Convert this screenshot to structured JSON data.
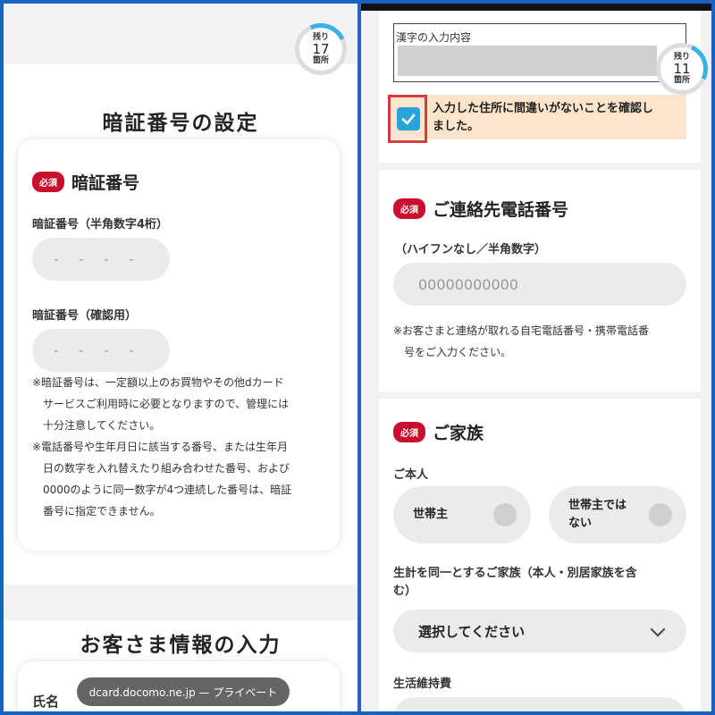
{
  "left": {
    "counter": {
      "prefix": "残り",
      "number": "17",
      "suffix": "箇所",
      "progress": 0.1
    },
    "pin_section": {
      "title": "暗証番号の設定",
      "badge": "必須",
      "field_title": "暗証番号",
      "label1": "暗証番号（半角数字4桁）",
      "placeholder1": "- - - -",
      "label2": "暗証番号（確認用）",
      "placeholder2": "- - - -",
      "note1_l1": "※暗証番号は、一定額以上のお買物やその他dカード",
      "note1_l2": "サービスご利用時に必要となりますので、管理には",
      "note1_l3": "十分注意してください。",
      "note2_l1": "※電話番号や生年月日に該当する番号、または生年月",
      "note2_l2": "日の数字を入れ替えたり組み合わせた番号、および",
      "note2_l3": "0000のように同一数字が4つ連続した番号は、暗証",
      "note2_l4": "番号に指定できません。"
    },
    "customer_section": {
      "title": "お客さま情報の入力",
      "name_label": "氏名"
    },
    "url_bar": "dcard.docomo.ne.jp — プライベート"
  },
  "right": {
    "counter": {
      "prefix": "残り",
      "number": "11",
      "suffix": "箇所",
      "progress": 0.25
    },
    "kanji_label": "漢字の入力内容",
    "confirm_line1": "入力した住所に間違いがないことを確認し",
    "confirm_line2": "ました。",
    "confirm_checked": true,
    "phone": {
      "badge": "必須",
      "title": "ご連絡先電話番号",
      "sublabel": "（ハイフンなし／半角数字）",
      "placeholder": "00000000000",
      "note_l1": "※お客さまと連絡が取れる自宅電話番号・携帯電話番",
      "note_l2": "号をご入力ください。"
    },
    "family": {
      "badge": "必須",
      "title": "ご家族",
      "self_label": "ご本人",
      "option1": "世帯主",
      "option2_l1": "世帯主では",
      "option2_l2": "ない",
      "household_label_l1": "生計を同一とするご家族（本人・別居家族を含",
      "household_label_l2": "む）",
      "select_value": "選択してください",
      "living_cost_label": "生活維持費"
    }
  },
  "colors": {
    "required_badge": "#c8102e",
    "accent_blue": "#2aa3d8",
    "frame_blue": "#1565c0",
    "highlight_red": "#d93a3a",
    "confirm_bg": "#fde4cc"
  }
}
